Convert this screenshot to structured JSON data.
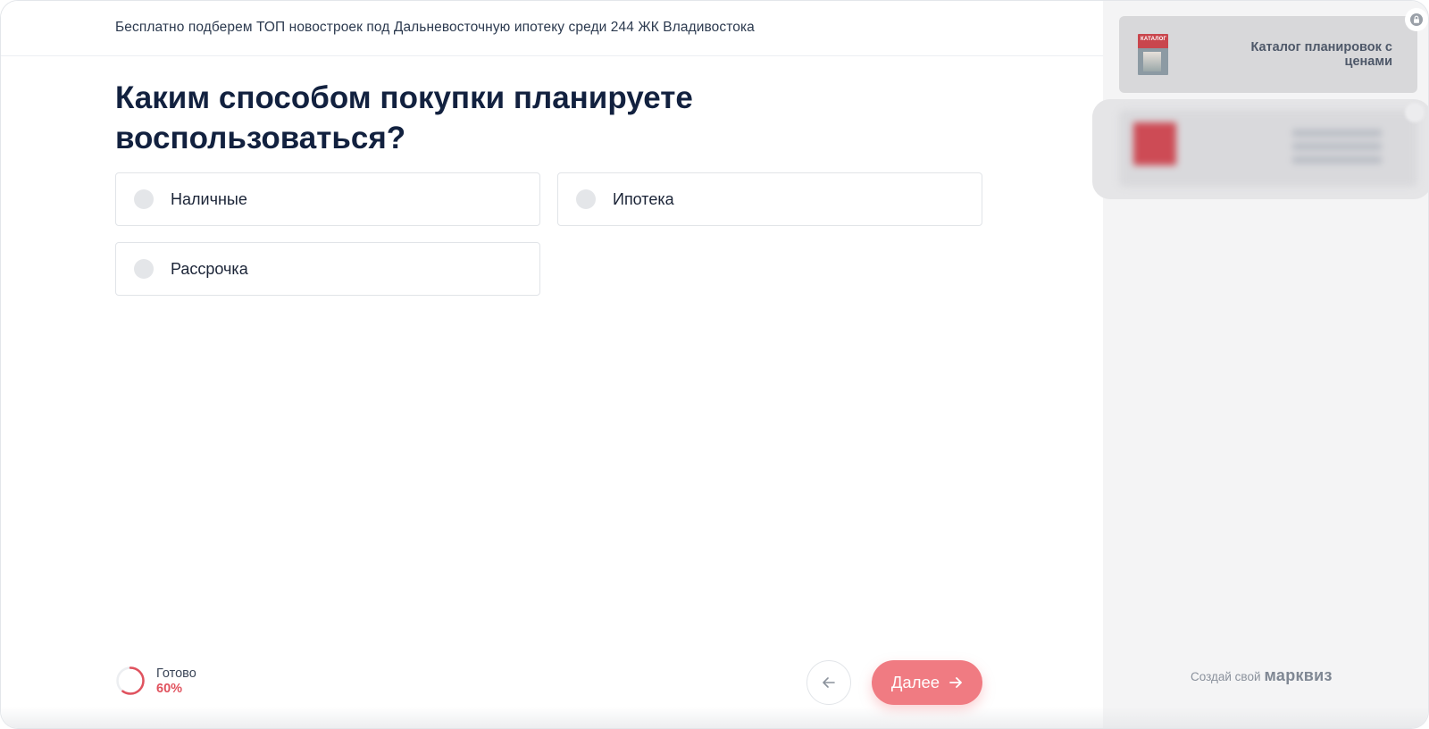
{
  "header": {
    "text": "Бесплатно подберем ТОП новостроек под Дальневосточную ипотеку среди 244 ЖК Владивостока"
  },
  "question": {
    "title": "Каким способом покупки планируете воспользоваться?"
  },
  "options": [
    {
      "label": "Наличные",
      "selected": false
    },
    {
      "label": "Ипотека",
      "selected": false
    },
    {
      "label": "Рассрочка",
      "selected": false
    }
  ],
  "progress": {
    "label": "Готово",
    "value_text": "60%",
    "value": 60
  },
  "nav": {
    "next_label": "Далее"
  },
  "sidebar": {
    "card_1": {
      "title": "Каталог планировок с ценами",
      "thumb_text": "КАТАЛОГ",
      "locked": true
    },
    "card_2": {
      "blurred": true
    },
    "brand": {
      "prefix": "Создай свой",
      "name": "марквиз"
    }
  },
  "colors": {
    "accent": "#f07b82",
    "progress": "#e0525e",
    "title": "#12213f",
    "sidebar_bg": "#f4f4f5"
  },
  "icons": {
    "back": "arrow-left-icon",
    "next": "arrow-right-icon",
    "lock": "lock-icon"
  }
}
